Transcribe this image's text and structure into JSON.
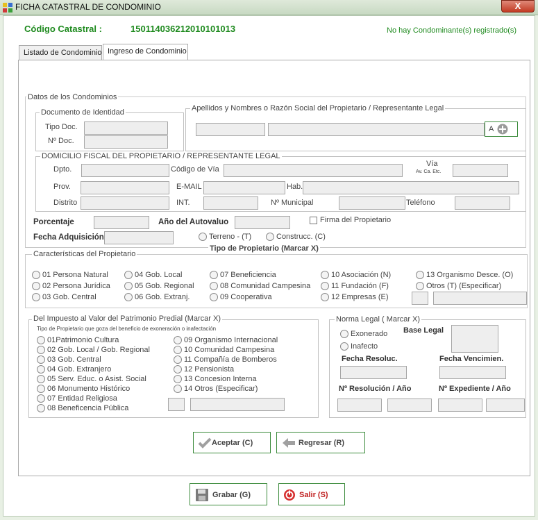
{
  "window": {
    "title": "FICHA CATASTRAL DE CONDOMINIO",
    "close_label": "X"
  },
  "header": {
    "code_label": "Código Catastral :",
    "code_value": "150114036212010101013",
    "status_text": "No hay Condominante(s) registrado(s)"
  },
  "tabs": [
    "Listado de Condominio",
    "Ingreso de Condominio"
  ],
  "datos": {
    "title": "Datos de los Condominios",
    "documento": {
      "title": "Documento de Identidad",
      "tipo_label": "Tipo Doc.",
      "nro_label": "Nº Doc."
    },
    "apellidos": {
      "title": "Apellidos y Nombres o Razón Social del Propietario / Representante Legal",
      "button_label": "A"
    },
    "domicilio": {
      "title": "DOMICILIO FISCAL DEL PROPIETARIO / REPRESENTANTE LEGAL",
      "dpto": "Dpto.",
      "codigo_via": "Código de Vía",
      "via": "Vía",
      "via_sub": "Av. Ca. Etc.",
      "prov": "Prov.",
      "email": "E-MAIL",
      "hab": "Hab.",
      "distrito": "Distrito",
      "int": "INT.",
      "municipal": "Nº Municipal",
      "telefono": "Teléfono"
    },
    "porcentaje": "Porcentaje",
    "anio_autovaluo": "Año del Autovaluo",
    "firma": "Firma del Propietario",
    "fecha_adquisicion": "Fecha Adquisición",
    "terreno": "Terreno - (T)",
    "construcc": "Construcc. (C)"
  },
  "caracteristicas": {
    "title": "Características del Propietario",
    "tipo_title": "Tipo de Propietario (Marcar X)",
    "col1": [
      "01 Persona Natural",
      "02 Persona Jurídica",
      "03 Gob. Central"
    ],
    "col2": [
      "04 Gob. Local",
      "05 Gob. Regional",
      "06 Gob. Extranj."
    ],
    "col3": [
      "07 Beneficiencia",
      "08 Comunidad Campesina",
      "09 Cooperativa"
    ],
    "col4": [
      "10 Asociación (N)",
      "11 Fundación (F)",
      "12 Empresas (E)"
    ],
    "col5": [
      "13 Organismo Desce. (O)",
      "Otros (T) (Especificar)"
    ]
  },
  "impuesto": {
    "title": "Del Impuesto al Valor del Patrimonio Predial (Marcar X)",
    "subtitle": "Tipo de Propietario que goza del beneficio de exoneración o inafectación",
    "col1": [
      "01Patrimonio Cultura",
      "02 Gob. Local / Gob. Regional",
      "03 Gob. Central",
      "04 Gob. Extranjero",
      "05 Serv. Educ. o Asist. Social",
      "06 Monumento Histórico",
      "07 Entidad Religiosa",
      "08 Beneficencia Pública"
    ],
    "col2": [
      "09 Organismo Internacional",
      "10 Comunidad Campesina",
      "11 Compañía de Bomberos",
      "12 Pensionista",
      "13 Concesion Interna",
      "14 Otros (Especificar)"
    ]
  },
  "norma": {
    "title": "Norma Legal ( Marcar X)",
    "exonerado": "Exonerado",
    "inafecto": "Inafecto",
    "base_legal": "Base Legal",
    "fecha_resoluc": "Fecha Resoluc.",
    "fecha_vencim": "Fecha Vencimien.",
    "nro_resolucion": "Nº Resolución / Año",
    "nro_expediente": "Nº Expediente / Año"
  },
  "buttons": {
    "aceptar": "Aceptar (C)",
    "regresar": "Regresar (R)",
    "grabar": "Grabar (G)",
    "salir": "Salir (S)"
  },
  "colors": {
    "accent_green": "#1e8a1e",
    "window_bg": "#e8f0e4"
  }
}
